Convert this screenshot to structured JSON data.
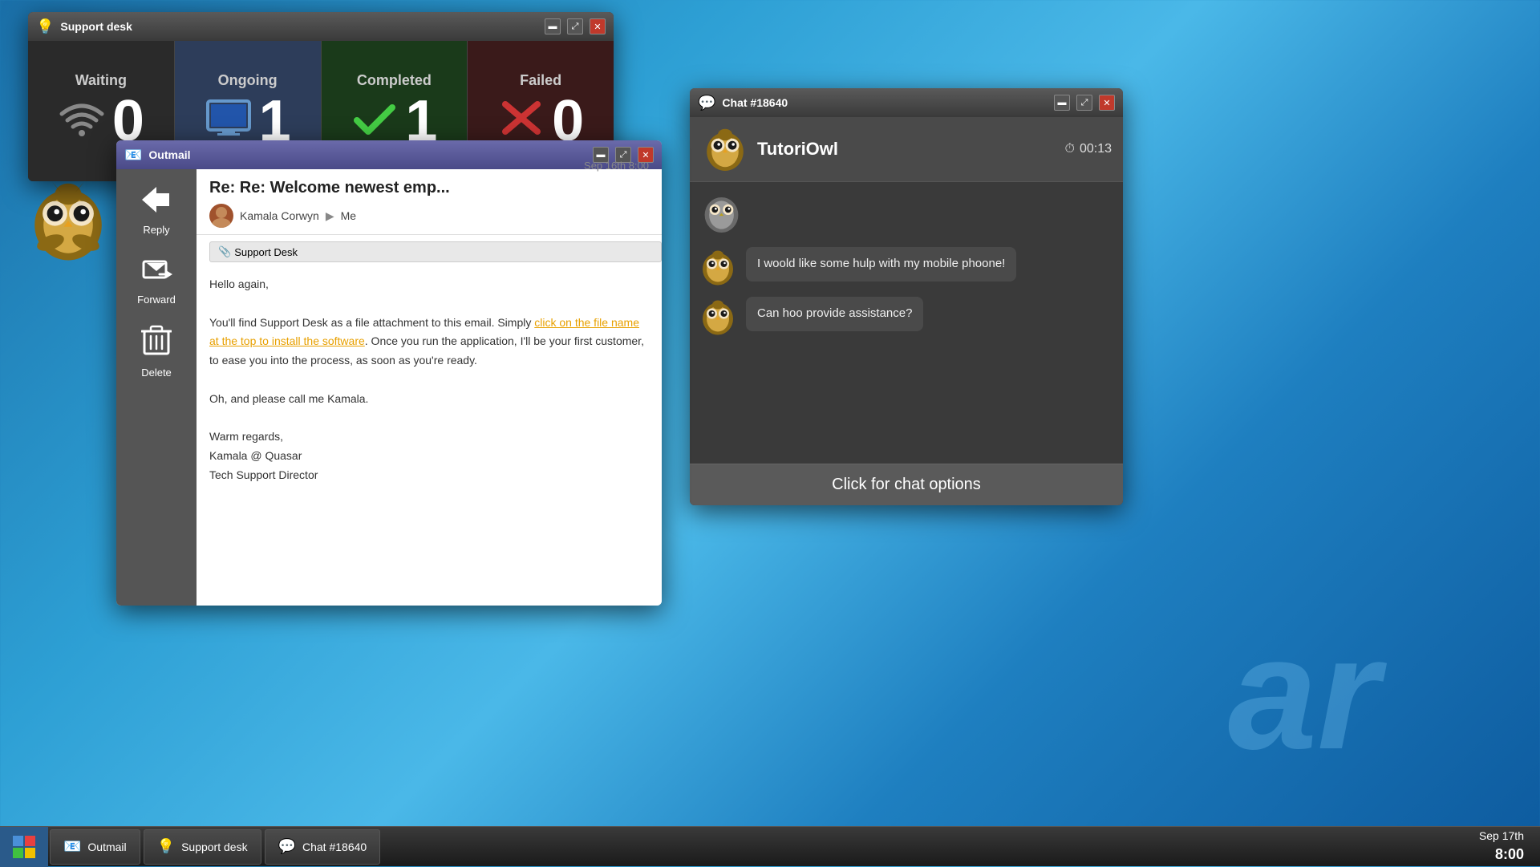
{
  "desktop": {
    "watermark": "ar"
  },
  "support_window": {
    "title": "Support desk",
    "stats": [
      {
        "label": "Waiting",
        "number": "0",
        "icon": "wifi",
        "theme": "waiting"
      },
      {
        "label": "Ongoing",
        "number": "1",
        "icon": "screen",
        "theme": "ongoing"
      },
      {
        "label": "Completed",
        "number": "1",
        "icon": "check",
        "theme": "completed"
      },
      {
        "label": "Failed",
        "number": "0",
        "icon": "cross",
        "theme": "failed"
      }
    ]
  },
  "outmail_window": {
    "title": "Outmail",
    "actions": [
      {
        "name": "reply",
        "label": "Reply"
      },
      {
        "name": "forward",
        "label": "Forward"
      },
      {
        "name": "delete",
        "label": "Delete"
      }
    ],
    "email": {
      "subject": "Re: Re: Welcome newest emp...",
      "date": "Sep 16th 8:00",
      "from": "Kamala Corwyn",
      "to": "Me",
      "attachment": "Support Desk",
      "body_lines": [
        "Hello again,",
        "",
        "You'll find Support Desk as a file attachment to this email. Simply click on the file name at the top to install the software. Once you run the application, I'll be your first customer, to ease you into the process, as soon as you're ready.",
        "",
        "Oh, and please call me Kamala.",
        "",
        "Warm regards,",
        "Kamala @ Quasar",
        "Tech Support Director"
      ],
      "link_text": "click on the file name at the top to install the software"
    }
  },
  "chat_window": {
    "title": "Chat #18640",
    "header_name": "TutoriOwl",
    "timer": "00:13",
    "messages": [
      {
        "id": 1,
        "text": "I woold like some hulp with my mobile phoone!"
      },
      {
        "id": 2,
        "text": "Can hoo provide assistance?"
      }
    ],
    "options_label": "Click for chat options"
  },
  "taskbar": {
    "items": [
      {
        "name": "outmail",
        "label": "Outmail"
      },
      {
        "name": "support-desk",
        "label": "Support desk"
      },
      {
        "name": "chat",
        "label": "Chat #18640"
      }
    ],
    "clock_date": "Sep 17th",
    "clock_time": "8:00"
  }
}
